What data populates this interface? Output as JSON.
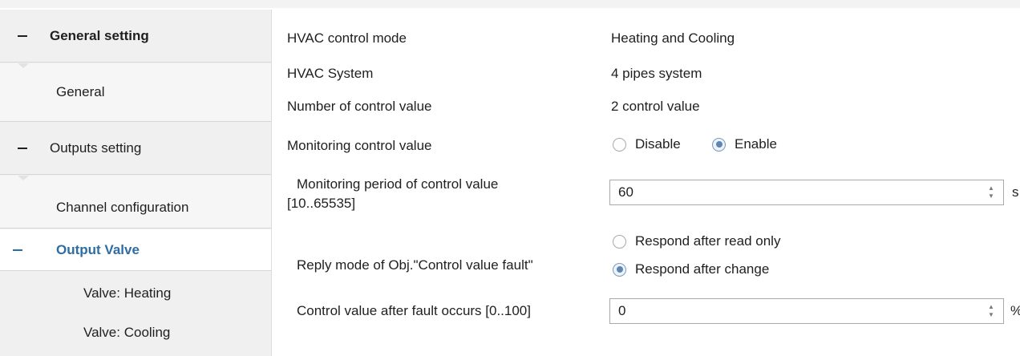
{
  "sidebar": {
    "items": [
      {
        "label": "General setting"
      },
      {
        "label": "General"
      },
      {
        "label": "Outputs setting"
      },
      {
        "label": "Channel configuration"
      },
      {
        "label": "Output Valve"
      },
      {
        "label": "Valve: Heating"
      },
      {
        "label": "Valve: Cooling"
      }
    ]
  },
  "params": {
    "hvac_mode": {
      "label": "HVAC control mode",
      "value": "Heating and Cooling"
    },
    "hvac_system": {
      "label": "HVAC System",
      "value": "4 pipes system"
    },
    "num_control": {
      "label": "Number of control value",
      "value": "2 control value"
    },
    "monitoring": {
      "label": "Monitoring control value",
      "options": [
        "Disable",
        "Enable"
      ],
      "selected": "Enable"
    },
    "monitoring_period": {
      "label_line1": "Monitoring period of control value",
      "label_line2": "[10..65535]",
      "value": "60",
      "unit": "s"
    },
    "reply_mode": {
      "label": "Reply mode of Obj.\"Control value fault\"",
      "options": [
        "Respond after read only",
        "Respond after change"
      ],
      "selected": "Respond after change"
    },
    "fault_value": {
      "label": "Control value after fault occurs [0..100]",
      "value": "0",
      "unit": "%"
    }
  },
  "colors": {
    "selected_text": "#2e6da4",
    "radio_checked": "#5e86b5"
  },
  "icons": {
    "collapse": "minus-icon",
    "spin_up": "arrow-up-icon",
    "spin_down": "arrow-down-icon"
  }
}
